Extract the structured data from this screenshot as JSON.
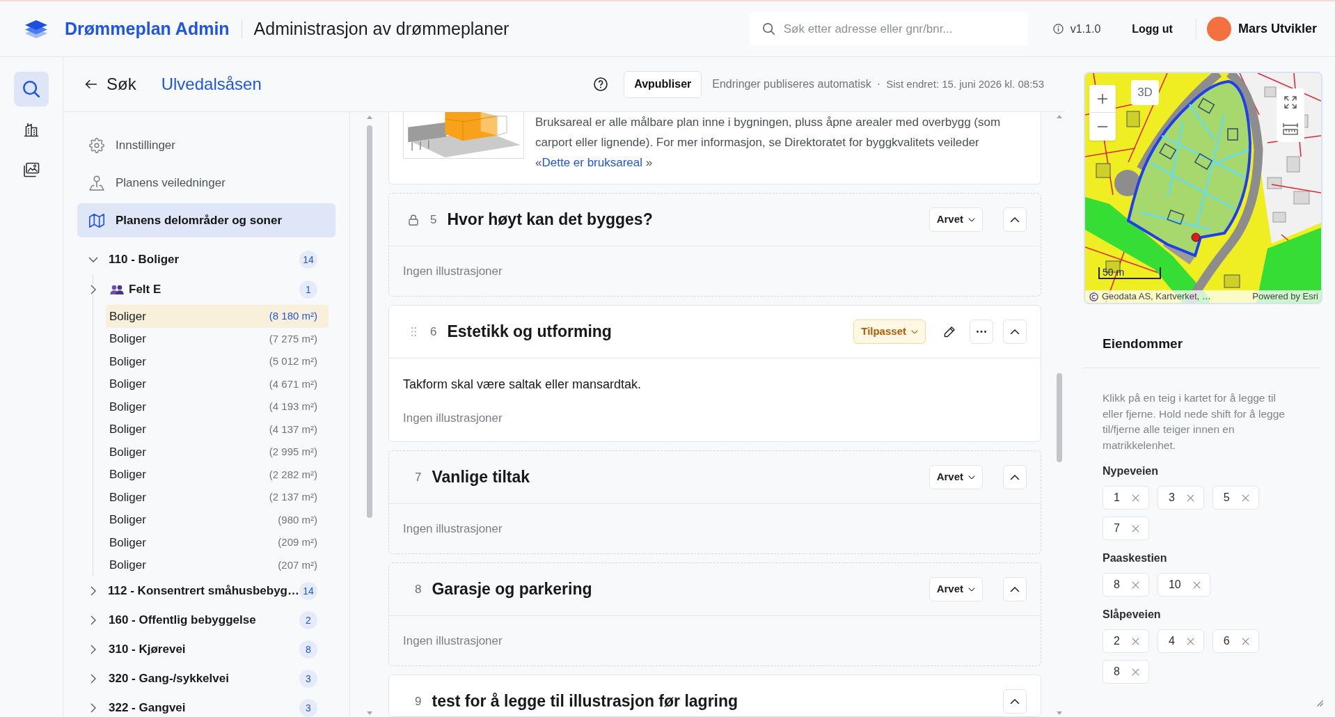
{
  "header": {
    "app_name": "Drømmeplan Admin",
    "page_title": "Administrasjon av drømmeplaner",
    "search": {
      "placeholder": "Søk etter adresse eller gnr/bnr..."
    },
    "version": "v1.1.0",
    "logout": "Logg ut",
    "user": {
      "name": "Mars Utvikler"
    }
  },
  "icon_rail": [
    {
      "kind": "search",
      "selected": true
    },
    {
      "kind": "building",
      "selected": false
    },
    {
      "kind": "images",
      "selected": false
    }
  ],
  "subheader": {
    "back": "Søk",
    "plan_name": "Ulvedalsåsen",
    "unpublish_button": "Avpubliser",
    "autopublish_note": "Endringer publiseres automatisk",
    "separator": "·",
    "last_changed": "Sist endret: 15. juni 2026 kl. 08:53"
  },
  "sidebar": {
    "nav": [
      {
        "kind": "settings",
        "label": "Innstillinger",
        "selected": false
      },
      {
        "kind": "guide",
        "label": "Planens veiledninger",
        "selected": false
      },
      {
        "kind": "map",
        "label": "Planens delområder og soner",
        "selected": true
      }
    ],
    "tree": [
      {
        "label": "110 - Boliger",
        "count": "14",
        "expanded": true,
        "children": [
          {
            "kind": "group",
            "label": "Felt E",
            "count": "1",
            "expanded": false
          },
          {
            "kind": "area",
            "label": "Boliger",
            "area": "(8 180 m²)",
            "selected": true
          },
          {
            "kind": "area",
            "label": "Boliger",
            "area": "(7 275 m²)",
            "selected": false
          },
          {
            "kind": "area",
            "label": "Boliger",
            "area": "(5 012 m²)",
            "selected": false
          },
          {
            "kind": "area",
            "label": "Boliger",
            "area": "(4 671 m²)",
            "selected": false
          },
          {
            "kind": "area",
            "label": "Boliger",
            "area": "(4 193 m²)",
            "selected": false
          },
          {
            "kind": "area",
            "label": "Boliger",
            "area": "(4 137 m²)",
            "selected": false
          },
          {
            "kind": "area",
            "label": "Boliger",
            "area": "(2 995 m²)",
            "selected": false
          },
          {
            "kind": "area",
            "label": "Boliger",
            "area": "(2 282 m²)",
            "selected": false
          },
          {
            "kind": "area",
            "label": "Boliger",
            "area": "(2 137 m²)",
            "selected": false
          },
          {
            "kind": "area",
            "label": "Boliger",
            "area": "(980 m²)",
            "selected": false
          },
          {
            "kind": "area",
            "label": "Boliger",
            "area": "(209 m²)",
            "selected": false
          },
          {
            "kind": "area",
            "label": "Boliger",
            "area": "(207 m²)",
            "selected": false
          }
        ]
      },
      {
        "label": "112 - Konsentrert småhusbebyg…",
        "count": "14",
        "expanded": false
      },
      {
        "label": "160 - Offentlig bebyggelse",
        "count": "2",
        "expanded": false
      },
      {
        "label": "310 - Kjørevei",
        "count": "8",
        "expanded": false
      },
      {
        "label": "320 - Gang-/sykkelvei",
        "count": "3",
        "expanded": false
      },
      {
        "label": "322 - Gangvei",
        "count": "3",
        "expanded": false
      }
    ]
  },
  "sections": [
    {
      "kind": "info",
      "text": "Bruksareal er alle målbare plan inne i bygningen, pluss åpne arealer med overbygg (som carport eller lignende). For mer informasjon, se Direktoratet for byggkvalitets veileder",
      "link": {
        "before": "«",
        "label": "Dette er bruksareal",
        "after": " »"
      }
    },
    {
      "kind": "section",
      "number": "5",
      "title": "Hvor høyt kan det bygges?",
      "locked": true,
      "draggable": false,
      "status": {
        "kind": "inherited",
        "label": "Arvet"
      },
      "editable": false,
      "expanded": true,
      "illustrations": "Ingen illustrasjoner"
    },
    {
      "kind": "section",
      "number": "6",
      "title": "Estetikk og utforming",
      "locked": false,
      "draggable": true,
      "status": {
        "kind": "custom",
        "label": "Tilpasset"
      },
      "editable": true,
      "expanded": true,
      "text": "Takform skal være saltak eller mansardtak.",
      "illustrations": "Ingen illustrasjoner"
    },
    {
      "kind": "section",
      "number": "7",
      "title": "Vanlige tiltak",
      "locked": false,
      "draggable": false,
      "status": {
        "kind": "inherited",
        "label": "Arvet"
      },
      "editable": false,
      "expanded": true,
      "illustrations": "Ingen illustrasjoner"
    },
    {
      "kind": "section",
      "number": "8",
      "title": "Garasje og parkering",
      "locked": false,
      "draggable": false,
      "status": {
        "kind": "inherited",
        "label": "Arvet"
      },
      "editable": false,
      "expanded": true,
      "illustrations": "Ingen illustrasjoner"
    },
    {
      "kind": "section",
      "number": "9",
      "title": "test for å legge til illustrasjon før lagring",
      "locked": false,
      "draggable": false,
      "editable": false,
      "expanded": true
    }
  ],
  "right_panel": {
    "map": {
      "mode_button": "3D",
      "scale": "50 m",
      "attribution": "Geodata AS, Kartverket, …",
      "powered_by": "Powered by Esri"
    },
    "title": "Eiendommer",
    "hint": "Klikk på en teig i kartet for å legge til eller fjerne. Hold nede shift for å legge til/fjerne alle teiger innen en matrikkelenhet.",
    "groups": [
      {
        "street": "Nypeveien",
        "numbers": [
          "1",
          "3",
          "5",
          "7"
        ]
      },
      {
        "street": "Paaskestien",
        "numbers": [
          "8",
          "10"
        ]
      },
      {
        "street": "Slåpeveien",
        "numbers": [
          "2",
          "4",
          "6",
          "8"
        ]
      }
    ]
  }
}
